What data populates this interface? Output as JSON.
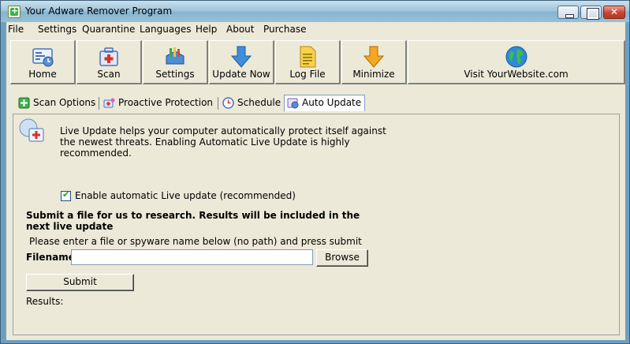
{
  "window": {
    "title": "Your Adware Remover Program"
  },
  "menu": [
    "File",
    "Settings",
    "Quarantine",
    "Languages",
    "Help",
    "About",
    "Purchase"
  ],
  "toolbar": {
    "home": "Home",
    "scan": "Scan",
    "settings": "Settings",
    "update_now": "Update Now",
    "log_file": "Log File",
    "minimize": "Minimize",
    "visit": "Visit YourWebsite.com"
  },
  "tabs": [
    "Scan Options",
    "Proactive Protection",
    "Schedule",
    "Auto Update"
  ],
  "active_tab": "Auto Update",
  "auto_update": {
    "description": "Live Update helps your computer automatically protect itself against the newest threats.  Enabling Automatic Live Update is highly recommended.",
    "checkbox_label": "Enable automatic Live update (recommended)",
    "checkbox_checked": true,
    "submit_title": "Submit a file for us to research.  Results will be included in the next live update",
    "hint": "Please enter a file or spyware name below (no path) and press submit",
    "filename_label": "Filename:",
    "filename_value": "",
    "browse_label": "Browse",
    "submit_label": "Submit",
    "results_label": "Results:"
  },
  "colors": {
    "accent": "#3f8fd8",
    "titlebar": "#9cc3da",
    "face": "#ece9d8"
  }
}
